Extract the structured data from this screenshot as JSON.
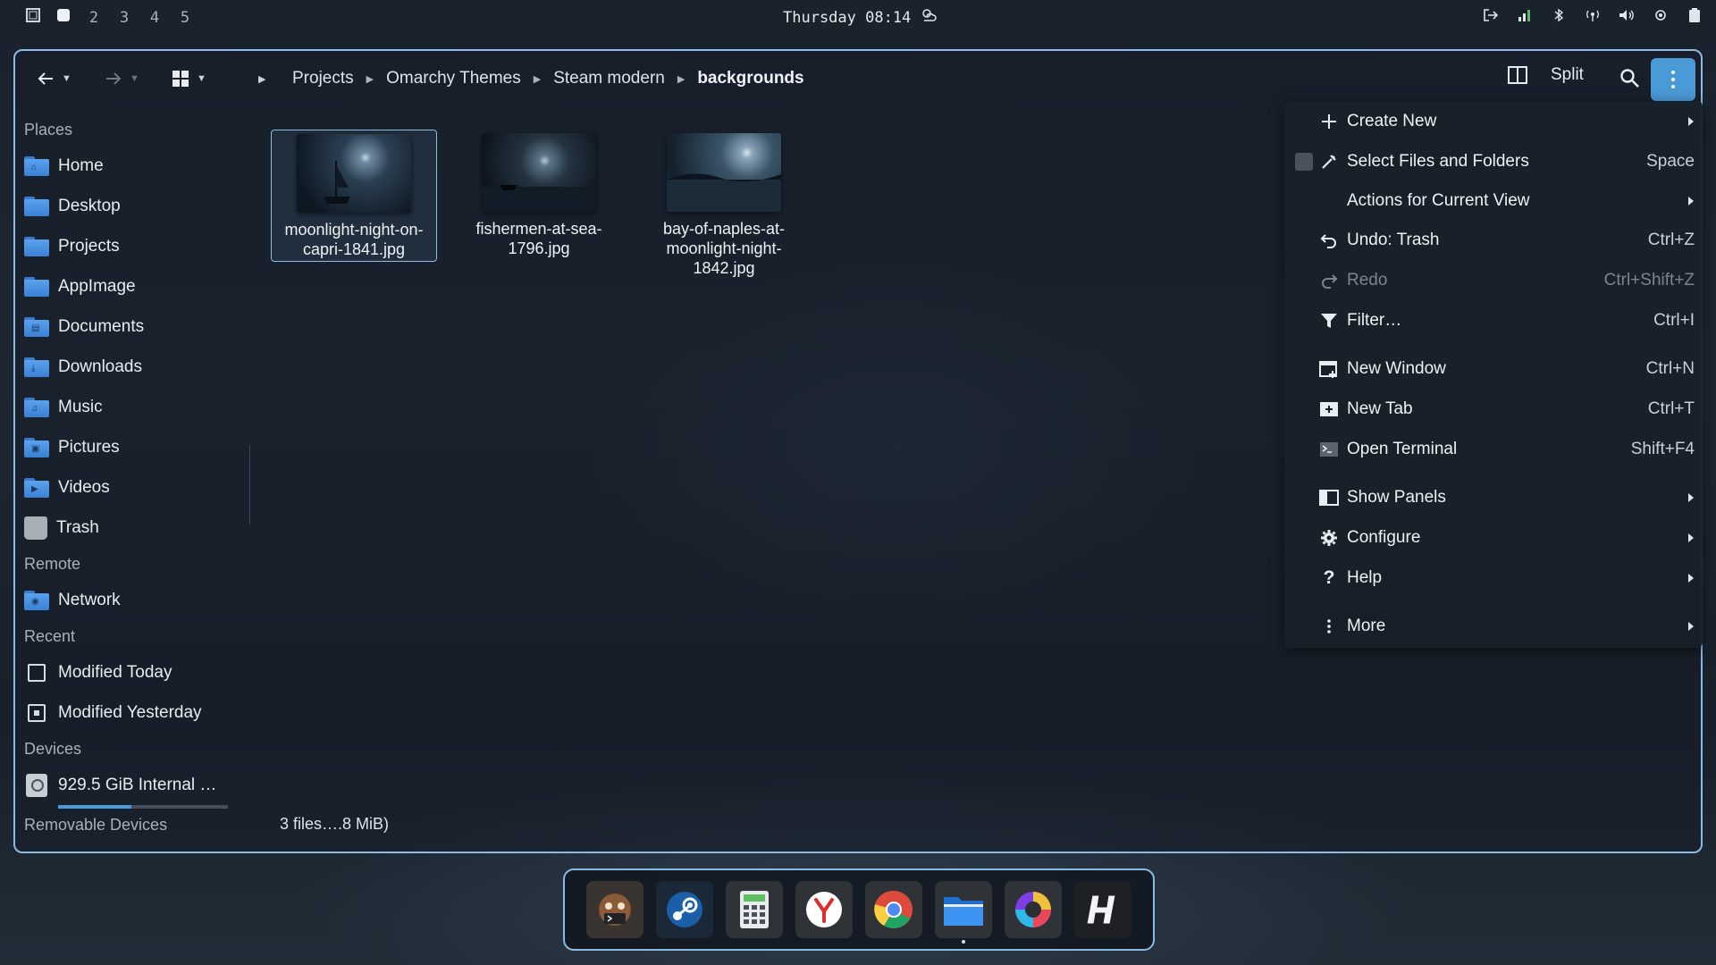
{
  "topbar": {
    "workspace_active_icon": "square-icon",
    "workspaces": [
      "2",
      "3",
      "4",
      "5"
    ],
    "clock": "Thursday 08:14",
    "tray_icons": [
      "logout-icon",
      "wifi-icon",
      "bluetooth-icon",
      "network-icon",
      "volume-icon",
      "cpu-icon",
      "battery-icon"
    ]
  },
  "toolbar": {
    "breadcrumb": [
      "Projects",
      "Omarchy Themes",
      "Steam modern",
      "backgrounds"
    ],
    "split_label": "Split"
  },
  "sidebar": {
    "places_label": "Places",
    "places": [
      {
        "label": "Home",
        "glyph": "⌂"
      },
      {
        "label": "Desktop",
        "glyph": ""
      },
      {
        "label": "Projects",
        "glyph": ""
      },
      {
        "label": "AppImage",
        "glyph": ""
      },
      {
        "label": "Documents",
        "glyph": "▤"
      },
      {
        "label": "Downloads",
        "glyph": "⤓"
      },
      {
        "label": "Music",
        "glyph": "♫"
      },
      {
        "label": "Pictures",
        "glyph": "▣"
      },
      {
        "label": "Videos",
        "glyph": "▶"
      }
    ],
    "trash_label": "Trash",
    "remote_label": "Remote",
    "network_label": "Network",
    "recent_label": "Recent",
    "recent": [
      "Modified Today",
      "Modified Yesterday"
    ],
    "devices_label": "Devices",
    "device_label": "929.5 GiB Internal …",
    "device_usage_fraction": 0.43,
    "removable_label": "Removable Devices"
  },
  "files": [
    {
      "name": "moonlight-night-on-capri-1841.jpg",
      "selected": true
    },
    {
      "name": "fishermen-at-sea-1796.jpg",
      "selected": false
    },
    {
      "name": "bay-of-naples-at-moonlight-night-1842.jpg",
      "selected": false
    }
  ],
  "status": "3 files….8 MiB)",
  "menu": {
    "items": [
      {
        "label": "Create New",
        "shortcut": "",
        "submenu": true,
        "icon": "plus-icon"
      },
      {
        "label": "Select Files and Folders",
        "shortcut": "Space",
        "submenu": false,
        "icon": "select-icon"
      },
      {
        "label": "Actions for Current View",
        "shortcut": "",
        "submenu": true,
        "icon": ""
      },
      {
        "label": "Undo: Trash",
        "shortcut": "Ctrl+Z",
        "submenu": false,
        "icon": "undo-icon"
      },
      {
        "label": "Redo",
        "shortcut": "Ctrl+Shift+Z",
        "submenu": false,
        "icon": "redo-icon",
        "disabled": true
      },
      {
        "label": "Filter…",
        "shortcut": "Ctrl+I",
        "submenu": false,
        "icon": "filter-icon"
      },
      {
        "label": "New Window",
        "shortcut": "Ctrl+N",
        "submenu": false,
        "icon": "new-window-icon"
      },
      {
        "label": "New Tab",
        "shortcut": "Ctrl+T",
        "submenu": false,
        "icon": "new-tab-icon"
      },
      {
        "label": "Open Terminal",
        "shortcut": "Shift+F4",
        "submenu": false,
        "icon": "terminal-icon"
      },
      {
        "label": "Show Panels",
        "shortcut": "",
        "submenu": true,
        "icon": "panels-icon"
      },
      {
        "label": "Configure",
        "shortcut": "",
        "submenu": true,
        "icon": "gear-icon"
      },
      {
        "label": "Help",
        "shortcut": "",
        "submenu": true,
        "icon": "help-icon"
      },
      {
        "label": "More",
        "shortcut": "",
        "submenu": true,
        "icon": "more-icon"
      }
    ]
  },
  "dock": {
    "apps": [
      "terminal-app-icon",
      "steam-app-icon",
      "calculator-app-icon",
      "yandex-browser-app-icon",
      "chrome-app-icon",
      "files-app-icon",
      "color-picker-app-icon",
      "hyprland-app-icon"
    ],
    "running_index": 5
  },
  "colors": {
    "accent": "#4a9ad7",
    "window_border": "#8bbbe2"
  }
}
